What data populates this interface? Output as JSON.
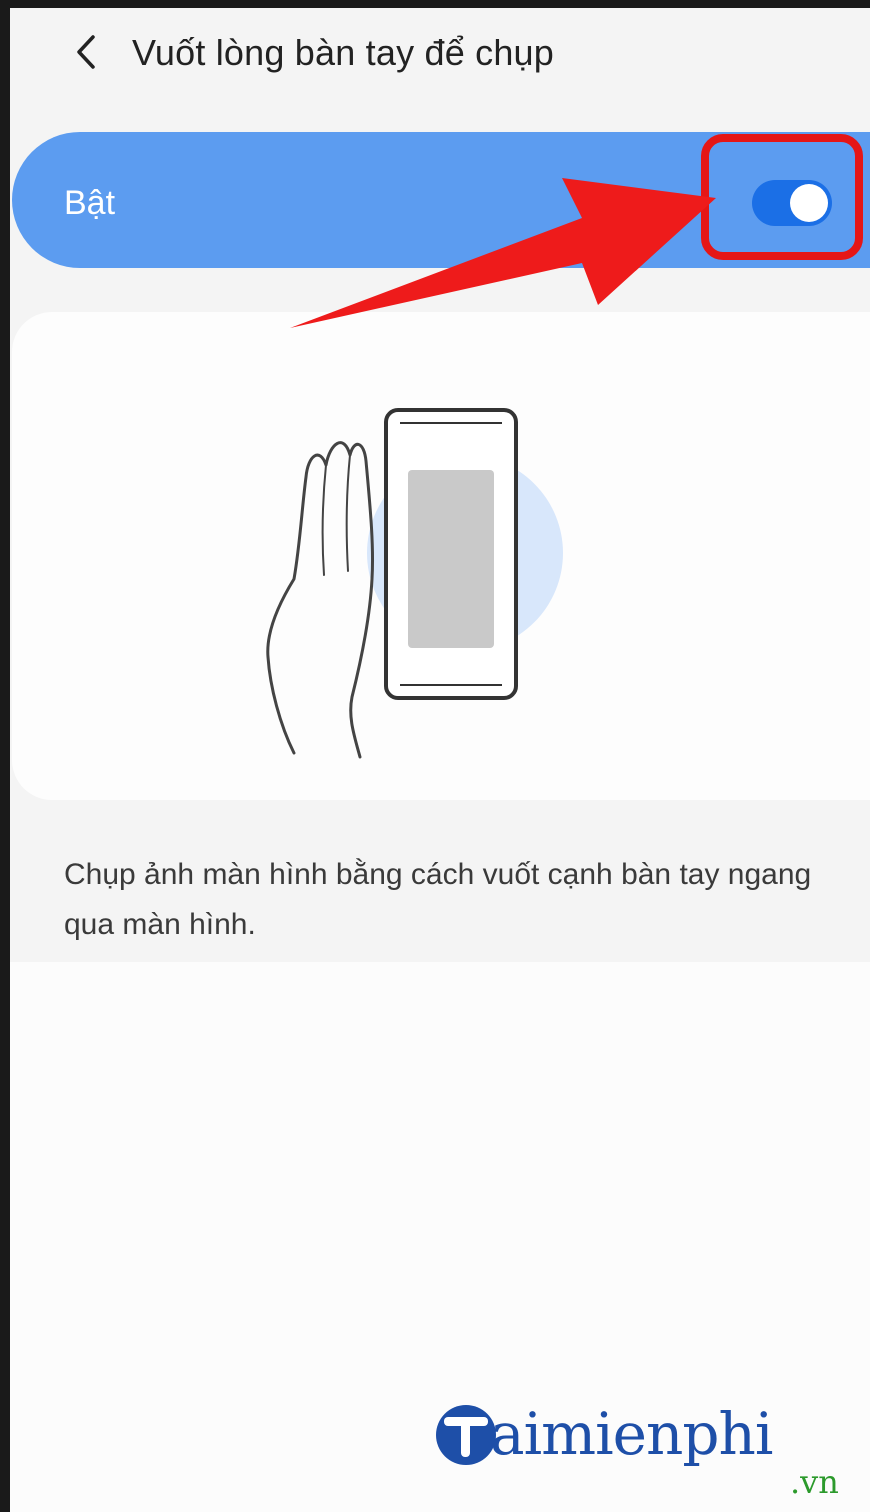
{
  "header": {
    "back_icon": "chevron-left-icon",
    "title": "Vuốt lòng bàn tay để chụp"
  },
  "master_switch": {
    "label": "Bật",
    "state": "on",
    "accent_color": "#5c9cf0",
    "toggle_color": "#1b6fe6"
  },
  "annotation": {
    "highlight_color": "#e51616",
    "arrow_icon": "red-arrow-icon"
  },
  "illustration": {
    "icon": "palm-swipe-illustration-icon"
  },
  "description": "Chụp ảnh màn hình bằng cách vuốt cạnh bàn tay ngang qua màn hình.",
  "watermark": {
    "brand": "aimienphi",
    "domain": ".vn",
    "logo_icon": "taimienphi-logo-icon",
    "main_color": "#1e4fa8",
    "sub_color": "#2c9a2c"
  }
}
